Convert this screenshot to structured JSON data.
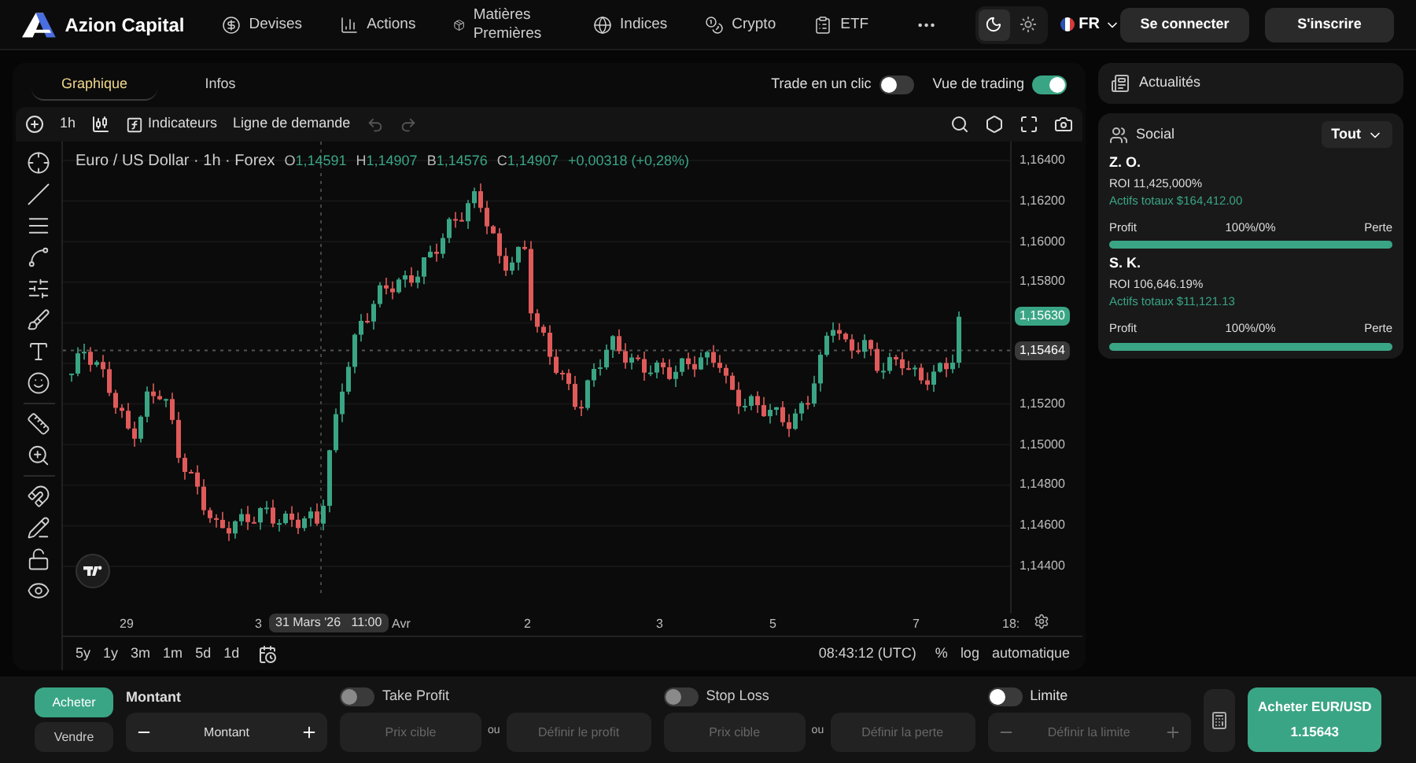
{
  "nav": {
    "brand": "Azion Capital",
    "items": [
      {
        "label": "Devises"
      },
      {
        "label": "Actions"
      },
      {
        "label": "Matières Premières"
      },
      {
        "label": "Indices"
      },
      {
        "label": "Crypto"
      },
      {
        "label": "ETF"
      }
    ],
    "themes": [
      {
        "kind": "moon",
        "selected": true
      },
      {
        "kind": "sun",
        "selected": false
      }
    ],
    "language": "FR",
    "buttons": [
      "Se connecter",
      "S'inscrire"
    ]
  },
  "tabs": [
    {
      "label": "Graphique",
      "selected": true
    },
    {
      "label": "Infos",
      "selected": false
    }
  ],
  "toggles": [
    {
      "label": "Trade en un clic",
      "on": false
    },
    {
      "label": "Vue de trading",
      "on": true
    }
  ],
  "chart_toolbar": {
    "interval": "1h",
    "indicators": "Indicateurs",
    "demand_line": "Ligne de demande"
  },
  "chart": {
    "title": "Euro / US Dollar · 1h · Forex",
    "ohlc": [
      {
        "key": "O",
        "value": "1,14591"
      },
      {
        "key": "H",
        "value": "1,14907"
      },
      {
        "key": "B",
        "value": "1,14576"
      },
      {
        "key": "C",
        "value": "1,14907"
      }
    ],
    "change": "+0,00318 (+0,28%)",
    "price_ticks": [
      "1,16400",
      "1,16200",
      "1,16000",
      "1,15800",
      "1,15200",
      "1,15000",
      "1,14800",
      "1,14600",
      "1,14400"
    ],
    "last_price": "1,15630",
    "crosshair_price": "1,15464",
    "time_ticks": [
      "29",
      "3",
      "Avr",
      "2",
      "3",
      "5",
      "7",
      "18:"
    ],
    "crosshair_time": "31 Mars '26   11:00",
    "ranges": [
      "5y",
      "1y",
      "3m",
      "1m",
      "5d",
      "1d"
    ],
    "clock": "08:43:12 (UTC)",
    "scale_options": [
      "%",
      "log",
      "automatique"
    ]
  },
  "news": {
    "label": "Actualités"
  },
  "social": {
    "label": "Social",
    "filter": "Tout",
    "traders": [
      {
        "name": "Z. O.",
        "roi": "ROI 11,425,000%",
        "assets": "Actifs totaux $164,412.00",
        "profit_label": "Profit",
        "ratio": "100%/0%",
        "loss_label": "Perte",
        "level": 1
      },
      {
        "name": "S. K.",
        "roi": "ROI 106,646.19%",
        "assets": "Actifs totaux $11,121.13",
        "profit_label": "Profit",
        "ratio": "100%/0%",
        "loss_label": "Perte",
        "level": 1
      }
    ]
  },
  "trade": {
    "sides": [
      {
        "label": "Acheter",
        "selected": true
      },
      {
        "label": "Vendre",
        "selected": false
      }
    ],
    "amount": {
      "label": "Montant",
      "placeholder": "Montant"
    },
    "take_profit": {
      "label": "Take Profit",
      "on": false,
      "disabled": true,
      "price_placeholder": "Prix cible",
      "or": "ou",
      "value_placeholder": "Définir le profit"
    },
    "stop_loss": {
      "label": "Stop Loss",
      "on": false,
      "disabled": true,
      "price_placeholder": "Prix cible",
      "or": "ou",
      "value_placeholder": "Définir la perte"
    },
    "limit": {
      "label": "Limite",
      "on": false,
      "disabled": false,
      "placeholder": "Définir la limite"
    },
    "submit": {
      "label": "Acheter EUR/USD",
      "price": "1.15643"
    }
  }
}
